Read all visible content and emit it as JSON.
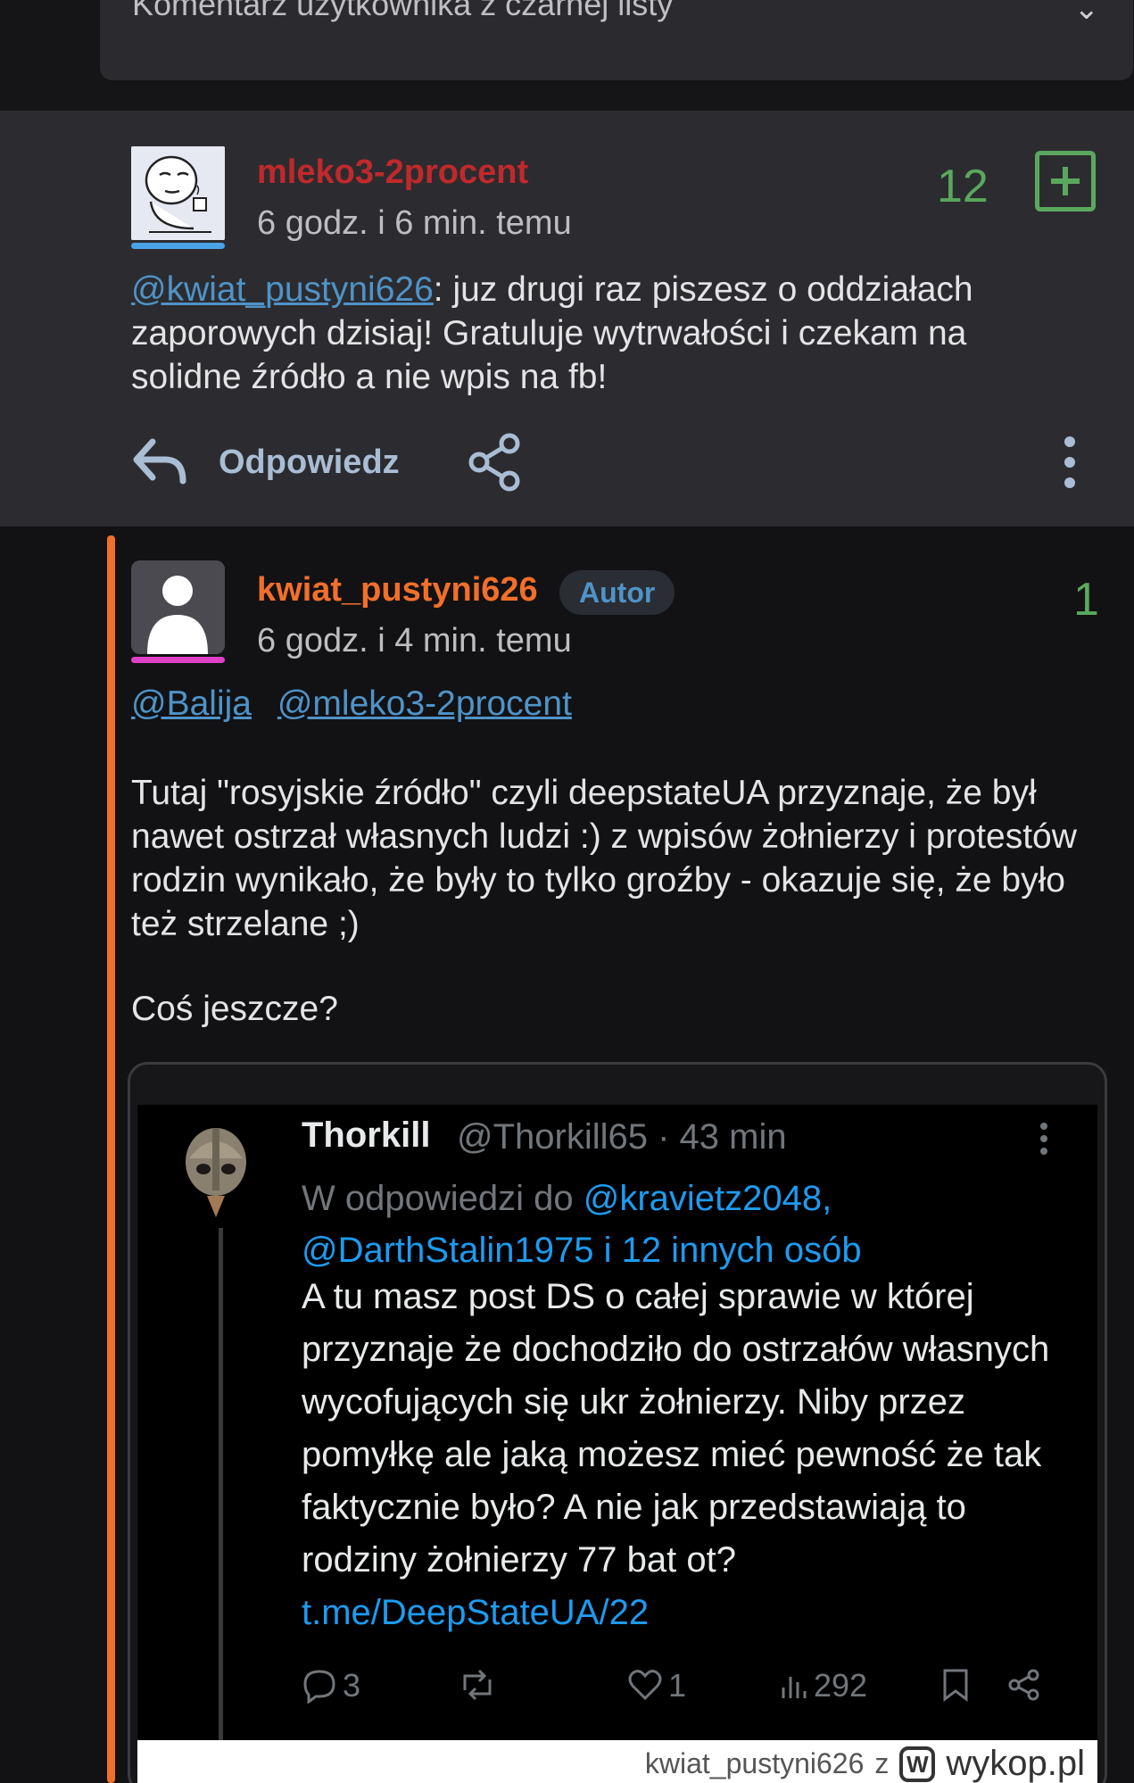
{
  "top_box": {
    "text": "Komentarz użytkownika z czarnej listy"
  },
  "comment1": {
    "username": "mleko3-2procent",
    "time": "6 godz. i 6 min. temu",
    "votes": "12",
    "mention": "@kwiat_pustyni626",
    "text": ": juz drugi raz piszesz o oddziałach zaporowych dzisiaj! Gratuluje wytrwałości i czekam na solidne źródło a nie wpis na fb!",
    "reply_label": "Odpowiedz"
  },
  "comment2": {
    "username": "kwiat_pustyni626",
    "badge": "Autor",
    "votes": "1",
    "time": "6 godz. i 4 min. temu",
    "mentions": [
      "@Balija",
      "@mleko3-2procent"
    ],
    "paragraph1": "Tutaj \"rosyjskie źródło\" czyli deepstateUA przyznaje, że był nawet ostrzał własnych ludzi :) z wpisów żołnierzy i protestów rodzin wynikało, że były to tylko groźby - okazuje się, że było też strzelane ;)",
    "paragraph2": "Coś jeszcze?"
  },
  "tweet": {
    "name": "Thorkill",
    "handle_time": "@Thorkill65 · 43 min",
    "reply_prefix": "W odpowiedzi do ",
    "reply_users": "@kravietz2048, @DarthStalin1975 i 12 innych osób",
    "text": "A tu masz post DS o całej sprawie w której przyznaje że dochodziło do ostrzałów własnych wycofujących się ukr żołnierzy. Niby przez pomyłkę ale jaką możesz mieć pewność że tak faktycznie było? A nie jak przedstawiają to rodziny żołnierzy 77 bat ot? ",
    "link": "t.me/DeepStateUA/22",
    "replies": "3",
    "likes": "1",
    "views": "292"
  },
  "watermark": {
    "user": "kwiat_pustyni626",
    "z": "z",
    "logo": "W",
    "site": "wykop.pl"
  },
  "colors": {
    "background": "#121214",
    "comment_bg": "#2c2c30",
    "username1": "#c0292b",
    "username2": "#f26f2a",
    "vote_green": "#5aa85e",
    "link_blue": "#4f93c8",
    "thread_orange": "#f26f2a"
  }
}
